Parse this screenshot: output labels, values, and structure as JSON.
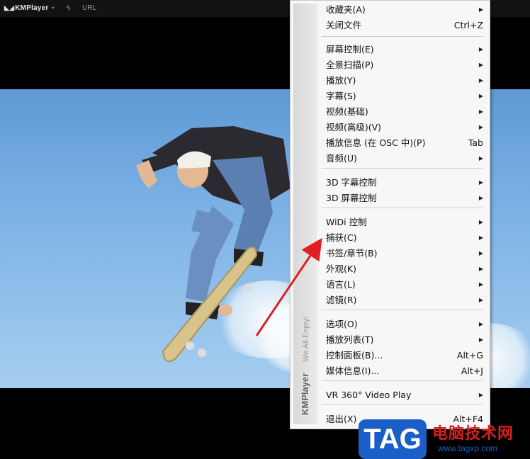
{
  "titlebar": {
    "app_name": "KMPlayer",
    "url_label": "URL"
  },
  "menu": {
    "items": [
      {
        "label": "收藏夹(A)",
        "shortcut": "",
        "submenu": true
      },
      {
        "label": "关闭文件",
        "shortcut": "Ctrl+Z",
        "submenu": false
      },
      {
        "label": "屏幕控制(E)",
        "shortcut": "",
        "submenu": true
      },
      {
        "label": "全景扫描(P)",
        "shortcut": "",
        "submenu": true
      },
      {
        "label": "播放(Y)",
        "shortcut": "",
        "submenu": true
      },
      {
        "label": "字幕(S)",
        "shortcut": "",
        "submenu": true
      },
      {
        "label": "视频(基础)",
        "shortcut": "",
        "submenu": true
      },
      {
        "label": "视频(高级)(V)",
        "shortcut": "",
        "submenu": true
      },
      {
        "label": "播放信息 (在 OSC 中)(P)",
        "shortcut": "Tab",
        "submenu": false
      },
      {
        "label": "音频(U)",
        "shortcut": "",
        "submenu": true
      },
      {
        "label": "3D 字幕控制",
        "shortcut": "",
        "submenu": true
      },
      {
        "label": "3D 屏幕控制",
        "shortcut": "",
        "submenu": true
      },
      {
        "label": "WiDi 控制",
        "shortcut": "",
        "submenu": true
      },
      {
        "label": "捕获(C)",
        "shortcut": "",
        "submenu": true
      },
      {
        "label": "书签/章节(B)",
        "shortcut": "",
        "submenu": true
      },
      {
        "label": "外观(K)",
        "shortcut": "",
        "submenu": true
      },
      {
        "label": "语言(L)",
        "shortcut": "",
        "submenu": true
      },
      {
        "label": "滤镜(R)",
        "shortcut": "",
        "submenu": true
      },
      {
        "label": "选项(O)",
        "shortcut": "",
        "submenu": true
      },
      {
        "label": "播放列表(T)",
        "shortcut": "",
        "submenu": true
      },
      {
        "label": "控制面板(B)...",
        "shortcut": "Alt+G",
        "submenu": false
      },
      {
        "label": "媒体信息(I)...",
        "shortcut": "Alt+J",
        "submenu": false
      },
      {
        "label": "VR 360° Video Play",
        "shortcut": "",
        "submenu": true
      },
      {
        "label": "退出(X)",
        "shortcut": "Alt+F4",
        "submenu": false
      }
    ],
    "side_brand": "KMPlayer",
    "side_slogan": "We All Enjoy!"
  },
  "watermark": {
    "tag": "TAG",
    "title": "电脑技术网",
    "url": "www.tagxp.com"
  },
  "colors": {
    "accent_arrow": "#e02020",
    "watermark_blue": "#1a5fc8",
    "watermark_red": "#d81e1e"
  }
}
